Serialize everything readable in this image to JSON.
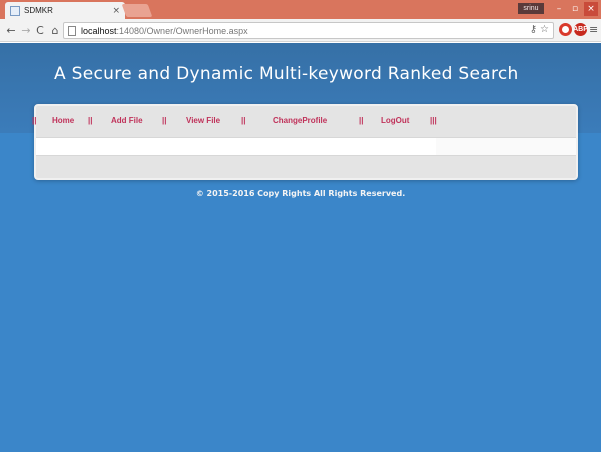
{
  "browser": {
    "tab_title": "SDMKR",
    "tab_close": "×",
    "user_badge": "srinu",
    "url_host": "localhost",
    "url_path": ":14080/Owner/OwnerHome.aspx",
    "window_controls": {
      "minimize": "–",
      "maximize": "▫",
      "close": "×"
    },
    "icons": [
      "back-icon",
      "forward-icon",
      "reload-icon",
      "home-icon",
      "page-icon",
      "key-icon",
      "star-icon",
      "opera-icon",
      "adblock-icon",
      "menu-icon"
    ],
    "abp_label": "ABP"
  },
  "site": {
    "title": "A Secure and Dynamic Multi-keyword Ranked Search",
    "menu": {
      "items": [
        {
          "label": "Home"
        },
        {
          "label": "Add File"
        },
        {
          "label": "View File"
        },
        {
          "label": "ChangeProfile"
        },
        {
          "label": "LogOut"
        }
      ],
      "separator": "||",
      "end_separator": "|||"
    },
    "footer": "© 2015-2016 Copy Rights All Rights Reserved."
  },
  "colors": {
    "page_bg": "#3b86c9",
    "header_bg": "#3670a6",
    "menu_text": "#c0325a",
    "tabstrip": "#d9755d"
  }
}
